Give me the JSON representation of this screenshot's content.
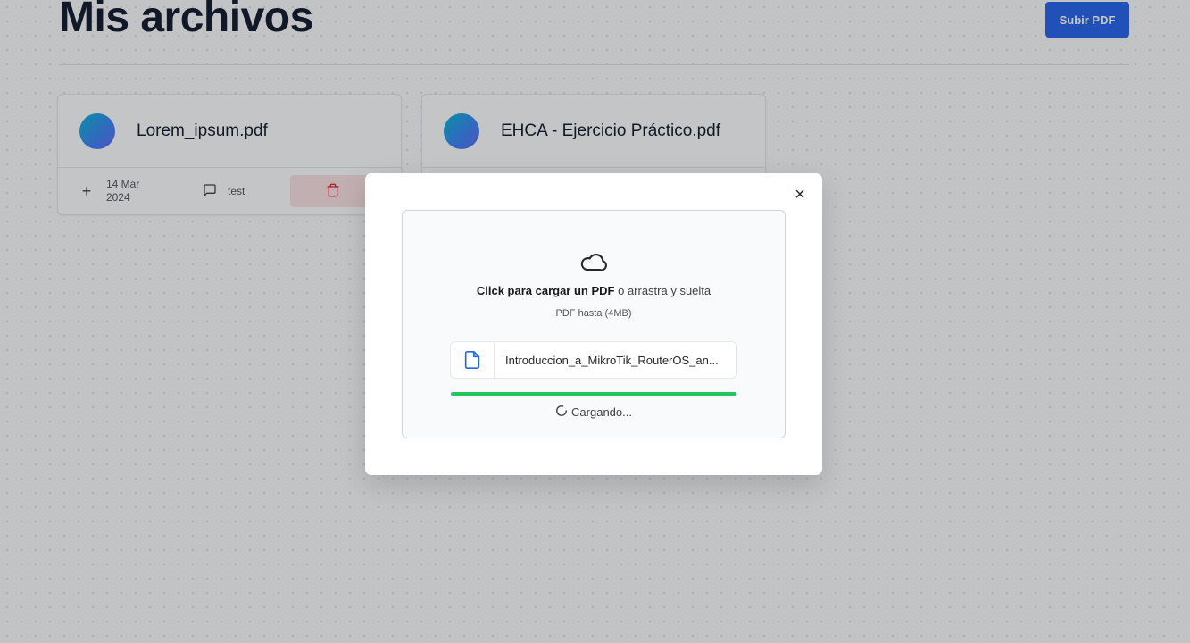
{
  "header": {
    "title": "Mis archivos",
    "upload_button": "Subir PDF"
  },
  "files": [
    {
      "name": "Lorem_ipsum.pdf",
      "date_line1": "14 Mar",
      "date_line2": "2024",
      "message": "test"
    },
    {
      "name": "EHCA - Ejercicio Práctico.pdf"
    }
  ],
  "modal": {
    "close_glyph": "×",
    "dropzone_bold": "Click para cargar un PDF",
    "dropzone_rest": " o arrastra y suelta",
    "dropzone_hint": "PDF hasta (4MB)",
    "file_name": "Introduccion_a_MikroTik_RouterOS_an...",
    "progress_fraction": 1.0,
    "loading_text": "Cargando..."
  },
  "colors": {
    "primary": "#2563eb",
    "progress": "#22c55e",
    "danger_bg": "#fee2e2",
    "danger_icon": "#dc2626"
  },
  "icons": {
    "upload_zone": "cloud-icon",
    "file": "file-icon",
    "loading": "spinner-icon",
    "delete": "trash-icon",
    "message": "message-icon",
    "add": "plus-icon"
  }
}
